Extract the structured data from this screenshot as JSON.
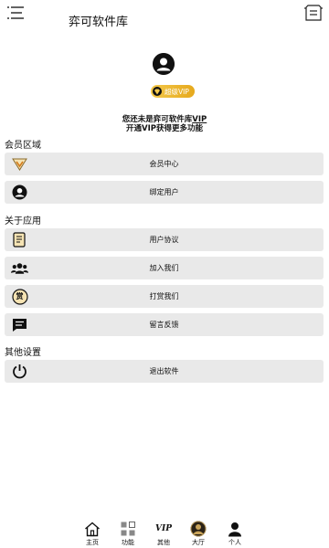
{
  "header": {
    "title": "弈可软件库"
  },
  "profile": {
    "vip_badge": "超级VIP",
    "line1_prefix": "您还未是弈可软件库",
    "line1_link": "VIP",
    "line2": "开通VIP获得更多功能"
  },
  "sections": {
    "member": {
      "title": "会员区域",
      "items": [
        {
          "label": "会员中心",
          "icon": "vip-crown-icon"
        },
        {
          "label": "绑定用户",
          "icon": "user-circle-icon"
        }
      ]
    },
    "about": {
      "title": "关于应用",
      "items": [
        {
          "label": "用户协议",
          "icon": "document-icon"
        },
        {
          "label": "加入我们",
          "icon": "group-icon"
        },
        {
          "label": "打赏我们",
          "icon": "reward-icon",
          "glyph": "赏"
        },
        {
          "label": "留言反馈",
          "icon": "message-icon"
        }
      ]
    },
    "other": {
      "title": "其他设置",
      "items": [
        {
          "label": "退出软件",
          "icon": "power-icon"
        }
      ]
    }
  },
  "tabbar": {
    "items": [
      {
        "label": "主页",
        "icon": "home-icon"
      },
      {
        "label": "功能",
        "icon": "grid-icon"
      },
      {
        "label": "其他",
        "icon": "vip-icon",
        "glyph": "VIP"
      },
      {
        "label": "大厅",
        "icon": "hall-icon"
      },
      {
        "label": "个人",
        "icon": "person-icon"
      }
    ]
  },
  "colors": {
    "row_bg": "#e9e9e9",
    "vip_gold": "#e6a91d",
    "text": "#111111"
  }
}
